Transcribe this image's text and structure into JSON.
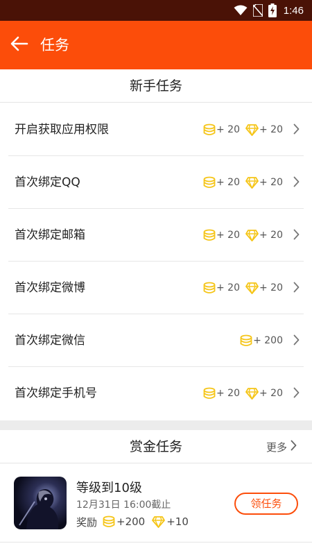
{
  "status_bar": {
    "time": "1:46",
    "icons": [
      "wifi-icon",
      "no-sim-icon",
      "battery-charging-icon"
    ]
  },
  "app_bar": {
    "title": "任务",
    "back_icon": "arrow-left-icon"
  },
  "colors": {
    "accent": "#fc4d0a",
    "status_bar": "#4a1206",
    "coin": "#f5c518",
    "diamond": "#f5c518"
  },
  "newbie_section": {
    "title": "新手任务"
  },
  "newbie_tasks": [
    {
      "label": "开启获取应用权限",
      "coin": "+ 20",
      "diamond": "+ 20"
    },
    {
      "label": "首次绑定QQ",
      "coin": "+ 20",
      "diamond": "+ 20"
    },
    {
      "label": "首次绑定邮箱",
      "coin": "+ 20",
      "diamond": "+ 20"
    },
    {
      "label": "首次绑定微博",
      "coin": "+ 20",
      "diamond": "+ 20"
    },
    {
      "label": "首次绑定微信",
      "coin": "+ 200"
    },
    {
      "label": "首次绑定手机号",
      "coin": "+ 20",
      "diamond": "+ 20"
    }
  ],
  "bounty_section": {
    "title": "赏金任务",
    "more": "更多"
  },
  "bounty_item": {
    "title": "等级到10级",
    "deadline": "12月31日 16:00截止",
    "reward_label": "奖励",
    "coin": "+200",
    "diamond": "+10",
    "button": "领任务"
  }
}
